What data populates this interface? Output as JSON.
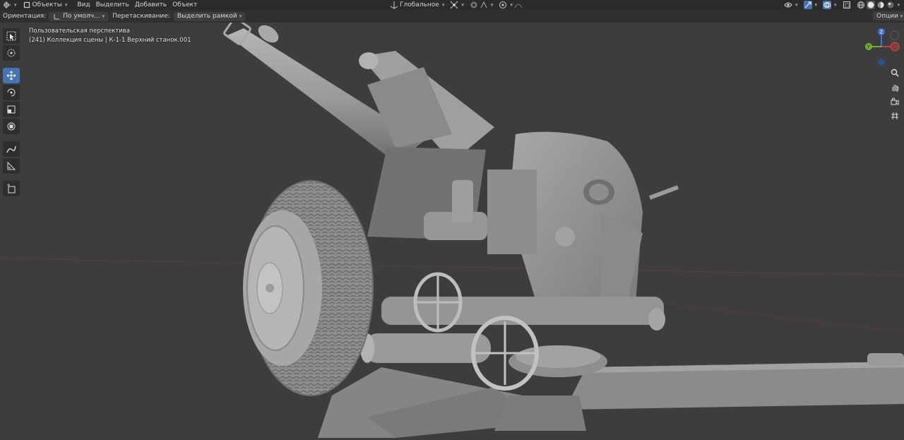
{
  "header": {
    "mode_label": "Объекты",
    "menu": [
      "Вид",
      "Выделить",
      "Добавить",
      "Объект"
    ],
    "transform_orientation": "Глобальное"
  },
  "tool_settings": {
    "orientation_label": "Ориентация:",
    "orientation_value": "По умолч...",
    "drag_label": "Перетаскивание:",
    "drag_value": "Выделить рамкой",
    "options_label": "Опции"
  },
  "viewport": {
    "view_name": "Пользовательская перспектива",
    "collection_info": "(241) Коллекция сцены | К-1-1 Верхний станок.001"
  },
  "gizmo": {
    "z": "Z",
    "y": "Y"
  },
  "colors": {
    "accent": "#4772b3",
    "viewport_bg": "#3d3d3d",
    "header_bg": "#2b2b2b"
  },
  "icons": [
    "editor-type-icon",
    "object-mode-icon",
    "transform-orientation-icon",
    "pivot-icon",
    "snap-icon",
    "proportional-icon",
    "visibility-icon",
    "gizmo-icon",
    "overlay-icon",
    "xray-icon",
    "shading-icons",
    "select-box-tool",
    "cursor-tool",
    "move-tool",
    "rotate-tool",
    "scale-tool",
    "transform-tool",
    "annotate-tool",
    "measure-tool",
    "add-cube-tool",
    "zoom-icon",
    "hand-icon",
    "camera-icon",
    "grid-icon"
  ]
}
